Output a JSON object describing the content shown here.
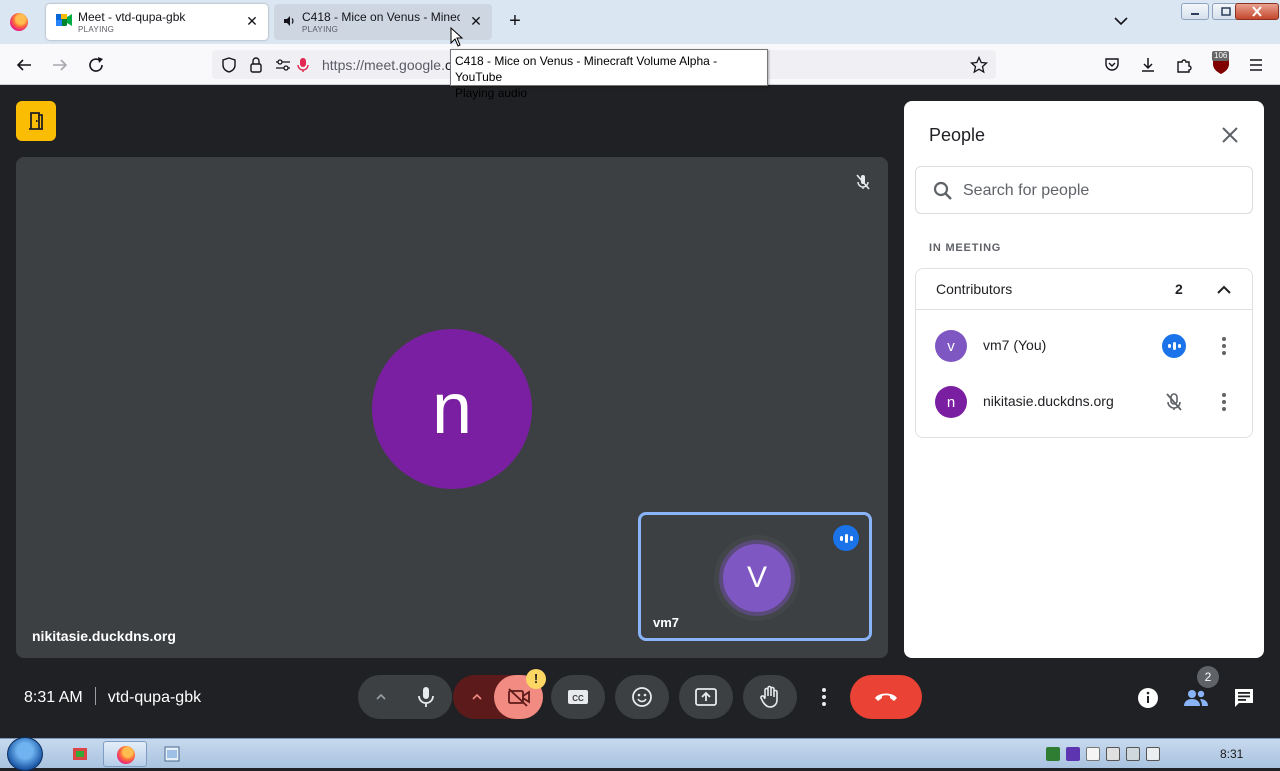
{
  "browser": {
    "tabs": [
      {
        "title": "Meet - vtd-qupa-gbk",
        "status": "PLAYING",
        "active": true
      },
      {
        "title": "C418 - Mice on Venus - Minecraft Volume Alpha - YouTube",
        "status": "PLAYING",
        "active": false
      }
    ],
    "url_prefix": "https://meet.google.",
    "url_host_visible": "c",
    "tooltip": {
      "line1": "C418 - Mice on Venus - Minecraft Volume Alpha - YouTube",
      "line2": "Playing audio"
    },
    "extension_badge": "106"
  },
  "meet": {
    "main_participant": {
      "initial": "n",
      "name": "nikitasie.duckdns.org",
      "avatar_color": "#7b1fa2"
    },
    "self_tile": {
      "initial": "V",
      "name": "vm7",
      "avatar_color": "#7e57c2"
    },
    "meeting_time": "8:31 AM",
    "meeting_code": "vtd-qupa-gbk",
    "camera_warning": "!",
    "people_count": "2",
    "accent": "#1a73e8",
    "end_call_color": "#ea4335"
  },
  "people_panel": {
    "title": "People",
    "search_placeholder": "Search for people",
    "section_label": "IN MEETING",
    "group": {
      "label": "Contributors",
      "count": "2"
    },
    "people": [
      {
        "initial": "v",
        "name": "vm7 (You)",
        "color": "#7e57c2",
        "status": "speaking"
      },
      {
        "initial": "n",
        "name": "nikitasie.duckdns.org",
        "color": "#7b1fa2",
        "status": "muted"
      }
    ]
  },
  "taskbar": {
    "clock": "8:31"
  }
}
